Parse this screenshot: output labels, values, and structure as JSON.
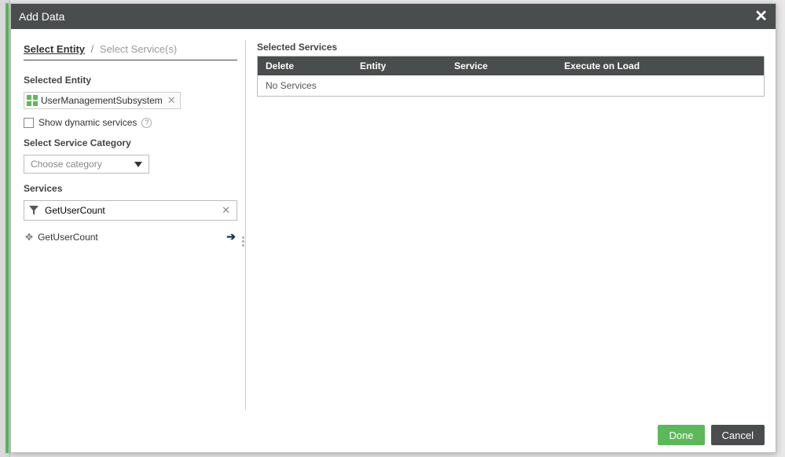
{
  "modal": {
    "title": "Add Data"
  },
  "breadcrumb": {
    "step1": "Select Entity",
    "sep": "/",
    "step2": "Select Service(s)"
  },
  "left": {
    "selectedEntityLabel": "Selected Entity",
    "entityChip": "UserManagementSubsystem",
    "showDynamic": "Show dynamic services",
    "qmark": "?",
    "categoryLabel": "Select Service Category",
    "categoryPlaceholder": "Choose category",
    "servicesLabel": "Services",
    "servicesFilterValue": "GetUserCount",
    "serviceItems": [
      "GetUserCount"
    ]
  },
  "right": {
    "title": "Selected Services",
    "cols": {
      "delete": "Delete",
      "entity": "Entity",
      "service": "Service",
      "execOnLoad": "Execute on Load"
    },
    "empty": "No Services"
  },
  "footer": {
    "done": "Done",
    "cancel": "Cancel"
  }
}
